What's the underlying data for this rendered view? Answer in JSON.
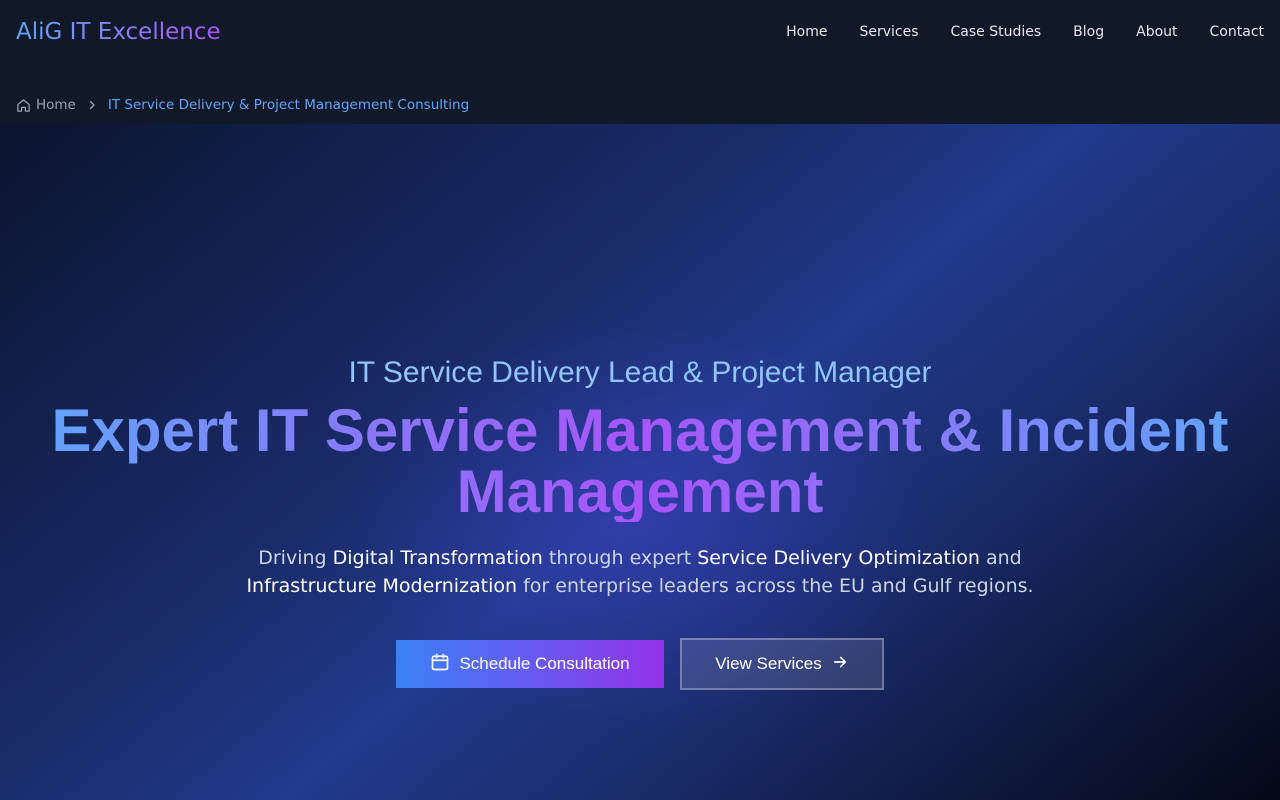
{
  "brand": {
    "name": "AliG IT Excellence"
  },
  "nav": {
    "items": [
      {
        "label": "Home"
      },
      {
        "label": "Services"
      },
      {
        "label": "Case Studies"
      },
      {
        "label": "Blog"
      },
      {
        "label": "About"
      },
      {
        "label": "Contact"
      }
    ]
  },
  "breadcrumb": {
    "home_label": "Home",
    "current_label": "IT Service Delivery & Project Management Consulting",
    "icons": [
      "home-icon",
      "chevron-right-icon"
    ]
  },
  "hero": {
    "eyebrow": "IT Service Delivery Lead & Project Manager",
    "headline": "Expert IT Service Management & Incident Management",
    "subtext": {
      "p1": "Driving ",
      "hl1": "Digital Transformation",
      "p2": " through expert ",
      "hl2": "Service Delivery Optimization",
      "p3": " and ",
      "hl3": "Infrastructure Modernization",
      "p4": " for enterprise leaders across the EU and Gulf regions."
    },
    "primary_cta": {
      "label": "Schedule Consultation",
      "icon": "calendar-icon"
    },
    "secondary_cta": {
      "label": "View Services",
      "icon": "arrow-right-icon"
    }
  },
  "colors": {
    "accent_blue": "#60a5fa",
    "accent_purple": "#a855f7",
    "header_bg": "#111827",
    "hero_deep": "#0b1530"
  }
}
